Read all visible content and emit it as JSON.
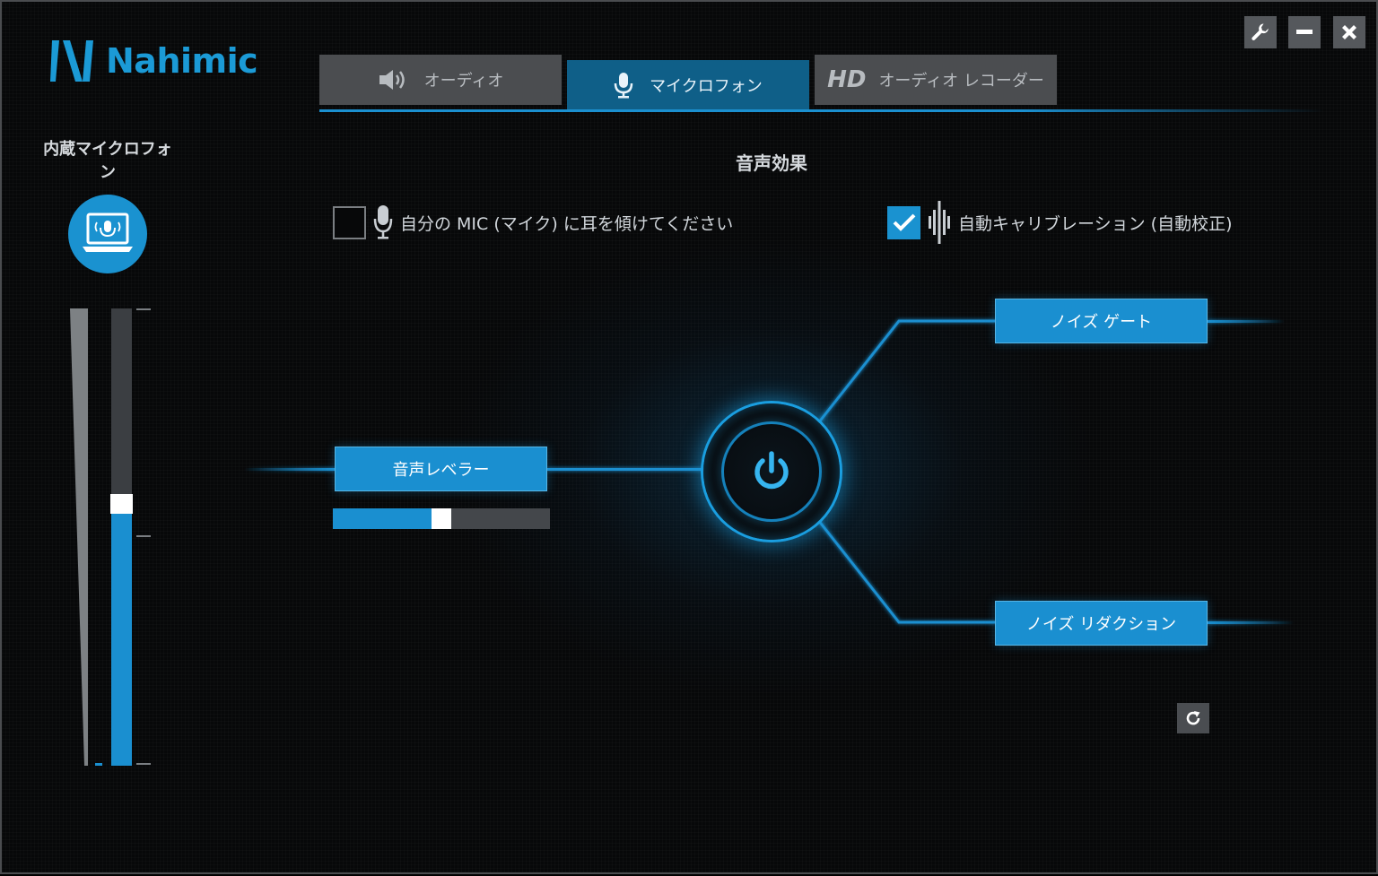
{
  "app": {
    "brand": "Nahimic"
  },
  "window_controls": {
    "settings_icon": "wrench-icon",
    "minimize_icon": "minimize-icon",
    "close_icon": "close-icon"
  },
  "tabs": [
    {
      "label": "オーディオ",
      "icon": "speaker-icon",
      "active": false
    },
    {
      "label": "マイクロフォン",
      "icon": "microphone-icon",
      "active": true
    },
    {
      "label": "オーディオ レコーダー",
      "prefix": "HD",
      "active": false
    }
  ],
  "device": {
    "name": "内蔵マイクロフォン",
    "icon": "laptop-microphone-icon",
    "level": 0.55
  },
  "effects": {
    "section_title": "音声効果",
    "listen_mic_label": "自分の MIC (マイク) に耳を傾けてください",
    "listen_mic_checked": false,
    "auto_calibration_label": "自動キャリブレーション (自動校正)",
    "auto_calibration_checked": true,
    "voice_leveler_label": "音声レベラー",
    "voice_leveler_level": 0.5,
    "noise_gate_label": "ノイズ ゲート",
    "noise_reduction_label": "ノイズ リダクション"
  },
  "colors": {
    "accent": "#1a8fd0",
    "tab_active": "#0f5f88",
    "tab_inactive": "#4b4d50",
    "background": "#070809"
  }
}
